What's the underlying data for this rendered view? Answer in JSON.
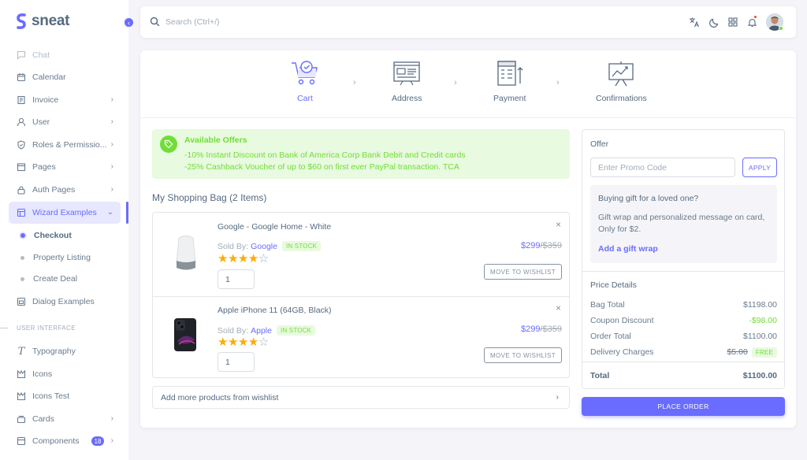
{
  "brand": {
    "name": "sneat",
    "logo_color": "#696cff"
  },
  "search": {
    "placeholder": "Search (Ctrl+/)"
  },
  "sidebar": {
    "items": [
      {
        "label": "Chat",
        "icon": "chat-icon"
      },
      {
        "label": "Calendar",
        "icon": "calendar-icon"
      },
      {
        "label": "Invoice",
        "icon": "invoice-icon"
      },
      {
        "label": "User",
        "icon": "user-icon"
      },
      {
        "label": "Roles & Permissio...",
        "icon": "shield-icon"
      },
      {
        "label": "Pages",
        "icon": "pages-icon"
      },
      {
        "label": "Auth Pages",
        "icon": "lock-icon"
      },
      {
        "label": "Wizard Examples",
        "icon": "wizard-icon"
      },
      {
        "label": "Dialog Examples",
        "icon": "dialog-icon"
      },
      {
        "label": "Typography",
        "icon": "typography-icon"
      },
      {
        "label": "Icons",
        "icon": "icons-icon"
      },
      {
        "label": "Icons Test",
        "icon": "icons-test-icon"
      },
      {
        "label": "Cards",
        "icon": "cards-icon"
      },
      {
        "label": "Components",
        "icon": "components-icon"
      }
    ],
    "sub_items": [
      "Checkout",
      "Property Listing",
      "Create Deal"
    ],
    "section_header": "USER INTERFACE",
    "components_badge": "18"
  },
  "steps": [
    {
      "label": "Cart",
      "icon": "cart-icon"
    },
    {
      "label": "Address",
      "icon": "address-icon"
    },
    {
      "label": "Payment",
      "icon": "payment-icon"
    },
    {
      "label": "Confirmations",
      "icon": "confirmation-icon"
    }
  ],
  "offers": {
    "title": "Available Offers",
    "lines": [
      "-10% Instant Discount on Bank of America Corp Bank Debit and Credit cards",
      "-25% Cashback Voucher of up to $60 on first ever PayPal transaction. TCA"
    ]
  },
  "bag": {
    "title": "My Shopping Bag (2 Items)",
    "sold_by_label": "Sold By:",
    "items": [
      {
        "name": "Google - Google Home - White",
        "seller": "Google",
        "stock": "IN STOCK",
        "rating": 4,
        "qty": "1",
        "price": "$299",
        "old_price": "/$359",
        "wishlist_label": "MOVE TO WISHLIST"
      },
      {
        "name": "Apple iPhone 11 (64GB, Black)",
        "seller": "Apple",
        "stock": "IN STOCK",
        "rating": 4,
        "qty": "1",
        "price": "$299",
        "old_price": "/$359",
        "wishlist_label": "MOVE TO WISHLIST"
      }
    ],
    "add_more": "Add more products from wishlist"
  },
  "offer_panel": {
    "title": "Offer",
    "promo_placeholder": "Enter Promo Code",
    "apply_label": "APPLY",
    "gift_question": "Buying gift for a loved one?",
    "gift_desc": "Gift wrap and personalized message on card, Only for $2.",
    "gift_link": "Add a gift wrap"
  },
  "price_details": {
    "title": "Price Details",
    "bag_total_label": "Bag Total",
    "bag_total": "$1198.00",
    "coupon_label": "Coupon Discount",
    "coupon": "-$98.00",
    "order_total_label": "Order Total",
    "order_total": "$1100.00",
    "delivery_label": "Delivery Charges",
    "delivery_old": "$5.00",
    "delivery_badge": "FREE",
    "total_label": "Total",
    "total": "$1100.00"
  },
  "place_order_label": "PLACE ORDER",
  "colors": {
    "primary": "#696cff",
    "success": "#71dd37",
    "warning": "#ffab00",
    "danger": "#ff3e1d"
  }
}
